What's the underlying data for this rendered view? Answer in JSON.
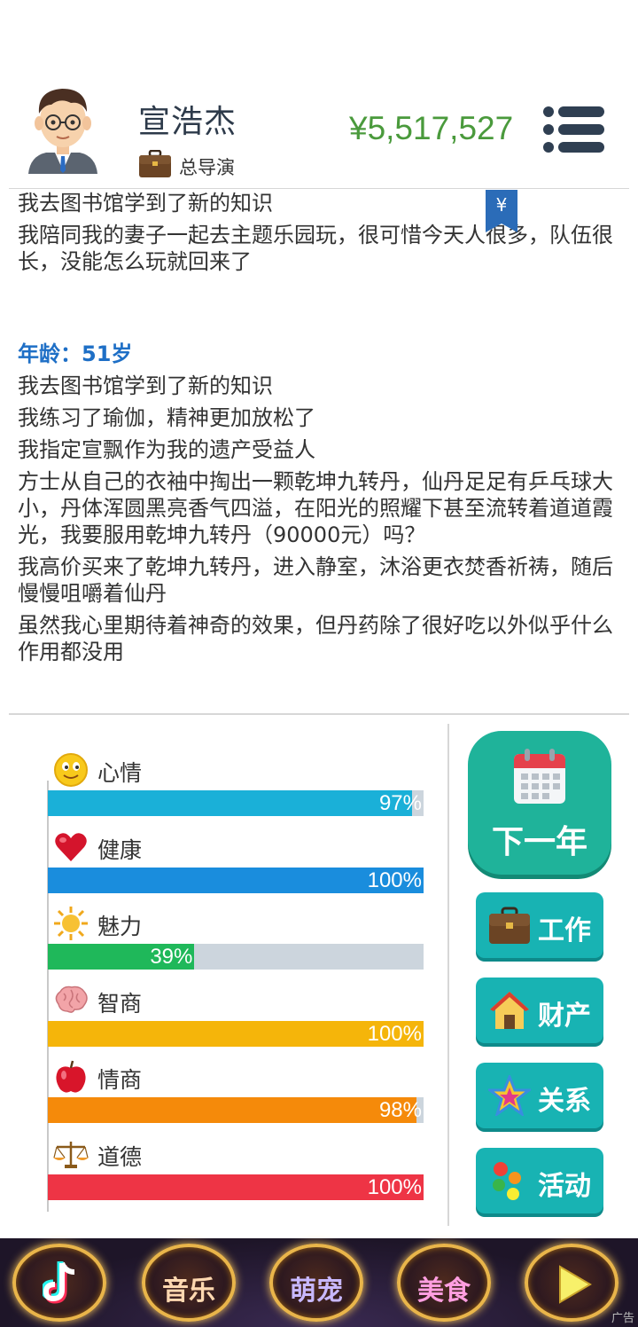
{
  "profile": {
    "name": "宣浩杰",
    "job_title": "总导演",
    "money": "¥5,517,527"
  },
  "bookmark": {
    "symbol": "¥"
  },
  "log": {
    "before": [
      "我去图书馆学到了新的知识",
      "我陪同我的妻子一起去主题乐园玩，很可惜今天人很多，队伍很长，没能怎么玩就回来了"
    ],
    "age_label": "年龄：51岁",
    "after": [
      "我去图书馆学到了新的知识",
      "我练习了瑜伽，精神更加放松了",
      "我指定宣飘作为我的遗产受益人",
      "方士从自己的衣袖中掏出一颗乾坤九转丹，仙丹足足有乒乓球大小，丹体浑圆黑亮香气四溢，在阳光的照耀下甚至流转着道道霞光，我要服用乾坤九转丹（90000元）吗？",
      "我高价买来了乾坤九转丹，进入静室，沐浴更衣焚香祈祷，随后慢慢咀嚼着仙丹",
      "虽然我心里期待着神奇的效果，但丹药除了很好吃以外似乎什么作用都没用"
    ]
  },
  "stats": [
    {
      "label": "心情",
      "pct_text": "97%",
      "value": 0.97,
      "color": "#1ab0d8",
      "icon": "smiley-face-icon"
    },
    {
      "label": "健康",
      "pct_text": "100%",
      "value": 1.0,
      "color": "#1a8ddd",
      "icon": "heart-icon"
    },
    {
      "label": "魅力",
      "pct_text": "39%",
      "value": 0.39,
      "color": "#1fb85a",
      "icon": "sun-icon"
    },
    {
      "label": "智商",
      "pct_text": "100%",
      "value": 1.0,
      "color": "#f5b50a",
      "icon": "brain-icon"
    },
    {
      "label": "情商",
      "pct_text": "98%",
      "value": 0.98,
      "color": "#f58a0a",
      "icon": "apple-icon"
    },
    {
      "label": "道德",
      "pct_text": "100%",
      "value": 1.0,
      "color": "#ee3445",
      "icon": "scales-icon"
    }
  ],
  "actions": {
    "next_year": "下一年",
    "work": "工作",
    "property": "财产",
    "relations": "关系",
    "activities": "活动"
  },
  "adbar": {
    "items": [
      "",
      "音乐",
      "萌宠",
      "美食",
      ""
    ],
    "tag": "广告"
  }
}
